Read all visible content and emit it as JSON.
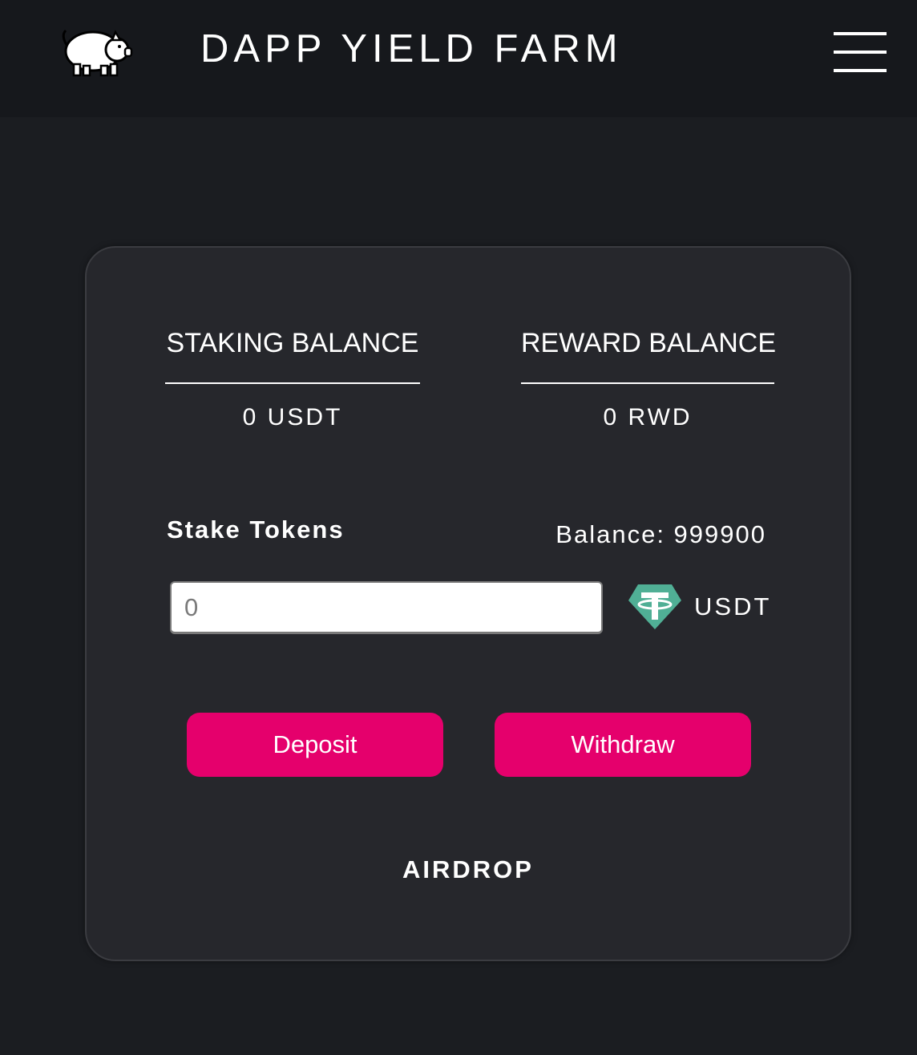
{
  "header": {
    "title": "DAPP YIELD FARM",
    "logo_icon": "pig-icon",
    "menu_icon": "hamburger-menu-icon"
  },
  "balances": {
    "staking_label": "STAKING BALANCE",
    "staking_value": "0 USDT",
    "reward_label": "REWARD BALANCE",
    "reward_value": "0 RWD"
  },
  "stake": {
    "label": "Stake Tokens",
    "balance_text": "Balance: 999900",
    "input_placeholder": "0",
    "token_icon": "tether-icon",
    "token_label": "USDT"
  },
  "actions": {
    "deposit_label": "Deposit",
    "withdraw_label": "Withdraw",
    "airdrop_label": "AIRDROP"
  },
  "colors": {
    "background": "#1b1d21",
    "navbar": "#16181c",
    "card": "#26272c",
    "accent": "#e5006c",
    "tether": "#50af95"
  }
}
